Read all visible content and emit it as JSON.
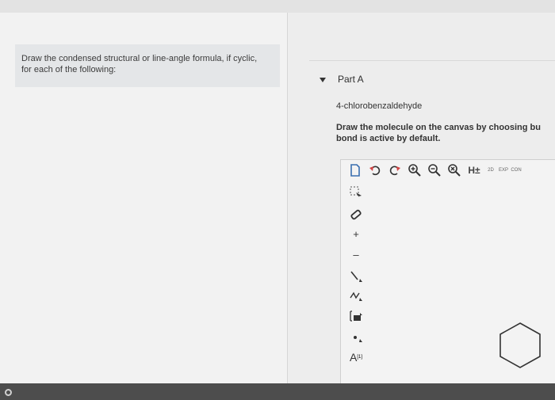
{
  "question": {
    "instruction_line1": "Draw the condensed structural or line-angle formula, if cyclic,",
    "instruction_line2": "for each of the following:"
  },
  "part": {
    "title": "Part A",
    "molecule": "4-chlorobenzaldehyde",
    "instruction_line1": "Draw the molecule on the canvas by choosing bu",
    "instruction_line2": "bond is active by default."
  },
  "toolbar": {
    "h_label": "H±",
    "label_2d": "2D",
    "label_exp": "EXP",
    "label_cont": "CON"
  },
  "lefttools": {
    "plus_label": "+",
    "minus_label": "–",
    "text_label": "A",
    "text_sup": "[1]"
  },
  "colors": {
    "bottom_bar": "#4d4d4d",
    "panel": "#f2f2f2",
    "instruction_box": "#e4e6e8"
  }
}
